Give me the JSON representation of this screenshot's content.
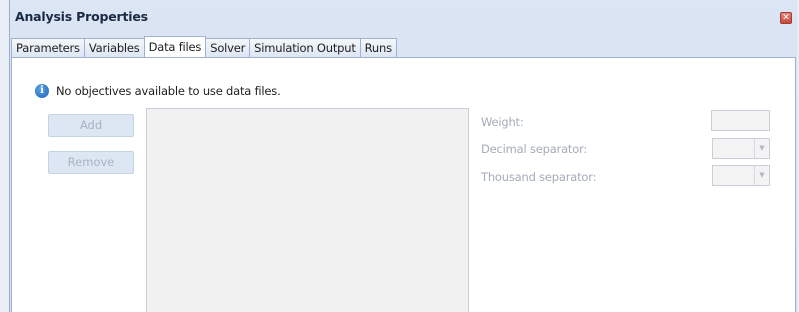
{
  "window": {
    "title": "Analysis Properties",
    "close_glyph": "✕"
  },
  "tabs": [
    {
      "label": "Parameters",
      "active": false
    },
    {
      "label": "Variables",
      "active": false
    },
    {
      "label": "Data files",
      "active": true
    },
    {
      "label": "Solver",
      "active": false
    },
    {
      "label": "Simulation Output",
      "active": false
    },
    {
      "label": "Runs",
      "active": false
    }
  ],
  "info": {
    "icon": "info-icon",
    "glyph": "i",
    "message": "No objectives available to use data files."
  },
  "buttons": {
    "add": "Add",
    "remove": "Remove"
  },
  "fields": {
    "weight_label": "Weight:",
    "weight_value": "",
    "decimal_label": "Decimal separator:",
    "decimal_value": "",
    "thousand_label": "Thousand separator:",
    "thousand_value": "",
    "dropdown_glyph": "▼"
  },
  "colors": {
    "window_bg": "#dbe5f3",
    "disabled_text": "#a4acb8",
    "info_blue": "#1f63b6"
  }
}
